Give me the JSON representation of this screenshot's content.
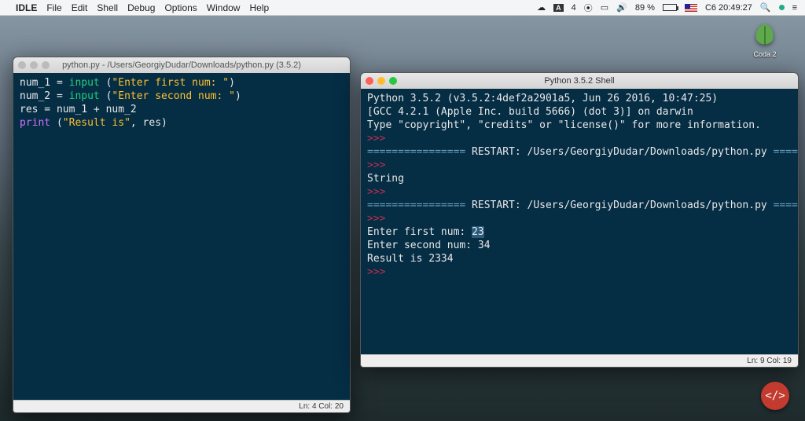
{
  "menubar": {
    "app": "IDLE",
    "items": [
      "File",
      "Edit",
      "Shell",
      "Debug",
      "Options",
      "Window",
      "Help"
    ],
    "adobe": "4",
    "battery": "89 %",
    "clock": "C6 20:49:27"
  },
  "desktop": {
    "leaf_label": "Coda 2"
  },
  "editor_window": {
    "title": "python.py - /Users/GeorgiyDudar/Downloads/python.py (3.5.2)",
    "status": "Ln: 4  Col: 20",
    "code": {
      "l1_var": "num_1",
      "l1_eq": " = ",
      "l1_fn": "input",
      "l1_p": " (",
      "l1_str": "\"Enter first num: \"",
      "l1_cp": ")",
      "l2_var": "num_2",
      "l2_eq": " = ",
      "l2_fn": "input",
      "l2_p": " (",
      "l2_str": "\"Enter second num: \"",
      "l2_cp": ")",
      "l3": "res = num_1 + num_2",
      "l4_fn": "print",
      "l4_p": " (",
      "l4_str": "\"Result is\"",
      "l4_c": ", res)"
    }
  },
  "shell_window": {
    "title": "Python 3.5.2 Shell",
    "status": "Ln: 9  Col: 19",
    "lines": {
      "banner1": "Python 3.5.2 (v3.5.2:4def2a2901a5, Jun 26 2016, 10:47:25)",
      "banner2": "[GCC 4.2.1 (Apple Inc. build 5666) (dot 3)] on darwin",
      "banner3": "Type \"copyright\", \"credits\" or \"license()\" for more information.",
      "prompt": ">>>",
      "sep": "================",
      "restart": " RESTART: /Users/GeorgiyDudar/Downloads/python.py ",
      "string_out": "String",
      "in1_label": "Enter first num: ",
      "in1_val": "23",
      "in2_label": "Enter second num: ",
      "in2_val": "34",
      "result": "Result is 2334"
    }
  },
  "codebadge": "</>"
}
